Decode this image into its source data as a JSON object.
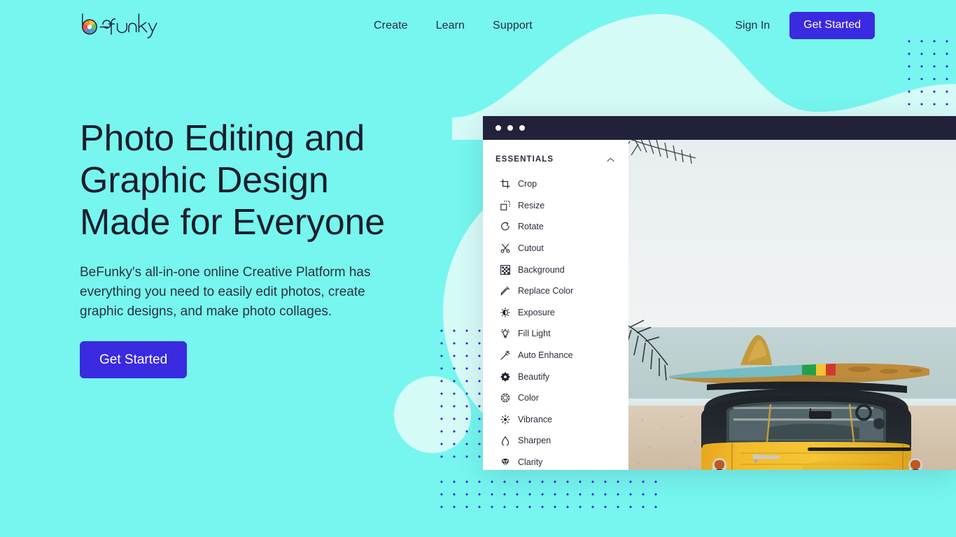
{
  "theme": {
    "page_background": "#76f6ef",
    "accent": "#3a2ae0",
    "dark": "#22213a",
    "pale_shape": "#d5fbf7",
    "text_dark": "#1d1d2c"
  },
  "header": {
    "logo_text": "befunky",
    "logo_icon": "aperture-icon",
    "nav": [
      {
        "label": "Create"
      },
      {
        "label": "Learn"
      },
      {
        "label": "Support"
      }
    ],
    "sign_in_label": "Sign In",
    "get_started_label": "Get Started"
  },
  "hero": {
    "heading_lines": [
      "Photo Editing and",
      "Graphic Design",
      "Made for Everyone"
    ],
    "heading": "Photo Editing and Graphic Design Made for Everyone",
    "subheading": "BeFunky's all-in-one online Creative Platform has everything you need to easily edit photos, create graphic designs, and make photo collages.",
    "cta_label": "Get Started"
  },
  "editor": {
    "titlebar_dots": 3,
    "panel": {
      "section_title": "ESSENTIALS",
      "collapse_icon": "chevron-up-icon",
      "tools": [
        {
          "label": "Crop",
          "icon": "crop-icon"
        },
        {
          "label": "Resize",
          "icon": "resize-icon"
        },
        {
          "label": "Rotate",
          "icon": "rotate-icon"
        },
        {
          "label": "Cutout",
          "icon": "scissors-icon"
        },
        {
          "label": "Background",
          "icon": "checkerboard-icon"
        },
        {
          "label": "Replace Color",
          "icon": "eyedropper-icon"
        },
        {
          "label": "Exposure",
          "icon": "exposure-icon"
        },
        {
          "label": "Fill Light",
          "icon": "bulb-icon"
        },
        {
          "label": "Auto Enhance",
          "icon": "magic-wand-icon"
        },
        {
          "label": "Beautify",
          "icon": "flower-icon"
        },
        {
          "label": "Color",
          "icon": "color-wheel-icon"
        },
        {
          "label": "Vibrance",
          "icon": "sparkle-icon"
        },
        {
          "label": "Sharpen",
          "icon": "triangle-icon"
        },
        {
          "label": "Clarity",
          "icon": "diamond-icon"
        }
      ]
    },
    "canvas": {
      "description": "Yellow vintage van rear view parked on a beach with a surfboard on the roof rack, palm fronds and ocean in background"
    }
  }
}
